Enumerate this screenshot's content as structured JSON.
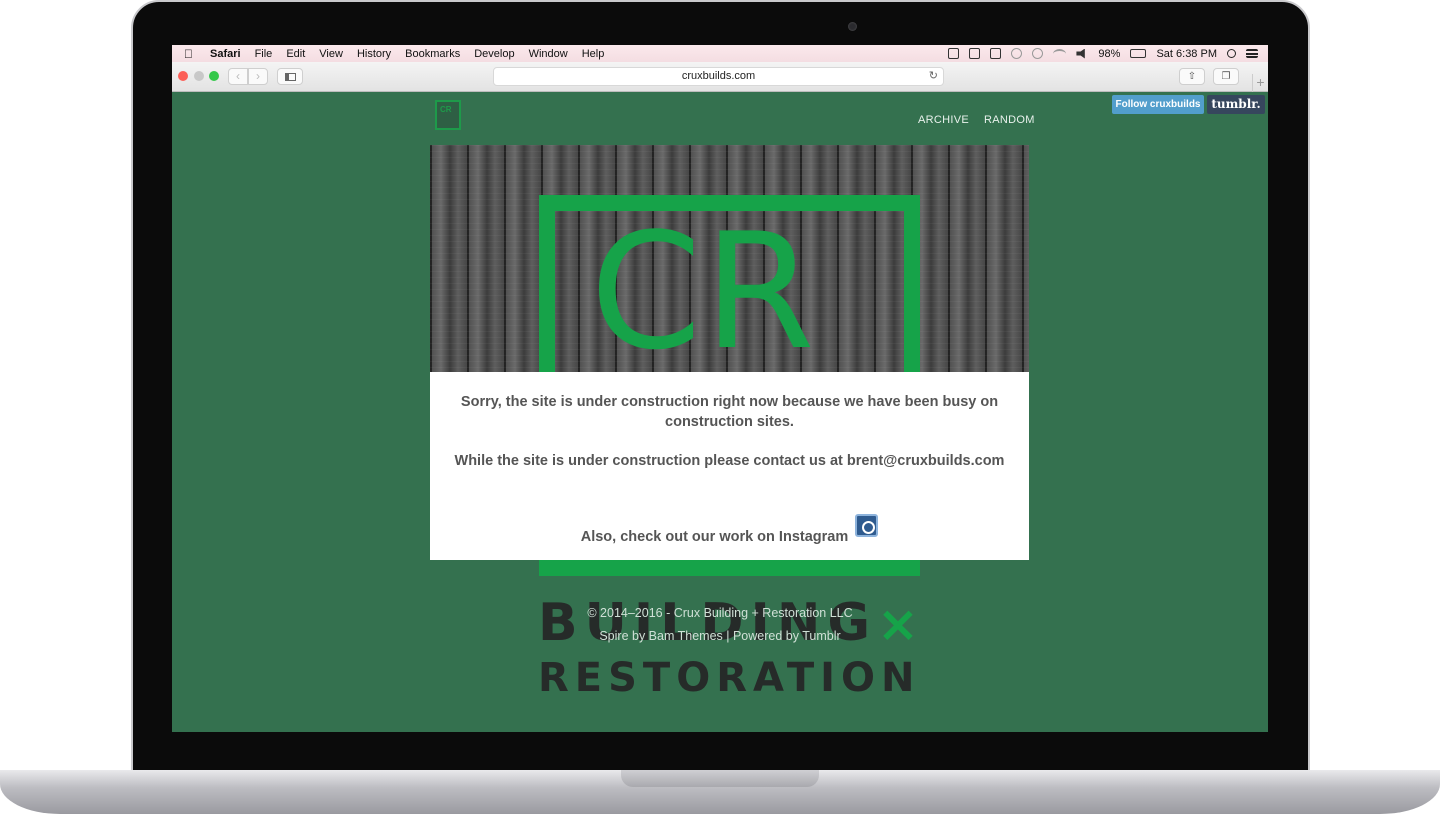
{
  "menubar": {
    "app_name": "Safari",
    "items": [
      "File",
      "Edit",
      "View",
      "History",
      "Bookmarks",
      "Develop",
      "Window",
      "Help"
    ],
    "battery": "98%",
    "clock": "Sat 6:38 PM"
  },
  "browser": {
    "url": "cruxbuilds.com",
    "back_icon": "chevron-left-icon",
    "forward_icon": "chevron-right-icon"
  },
  "site": {
    "nav": [
      "ARCHIVE",
      "RANDOM"
    ],
    "tumblr_follow": "Follow cruxbuilds",
    "tumblr_logo": "tumblr.",
    "hero_letters": "CR",
    "brand_line1": "BUILDING",
    "brand_line2": "RESTORATION",
    "brand_x": "×",
    "notice": {
      "line1": "Sorry, the site is under construction right now because we have been busy on construction sites.",
      "line2": "While the site is under construction please contact us at brent@cruxbuilds.com",
      "line3": "Also, check out our work on Instagram"
    },
    "footer": {
      "copyright": "© 2014–2016 - Crux Building + Restoration LLC",
      "credits": "Spire by Bam Themes | Powered by Tumblr"
    }
  },
  "colors": {
    "page_bg": "#34714f",
    "brand_green": "#16a349",
    "tumblr_blue": "#529ecc",
    "tumblr_navy": "#36465d"
  }
}
